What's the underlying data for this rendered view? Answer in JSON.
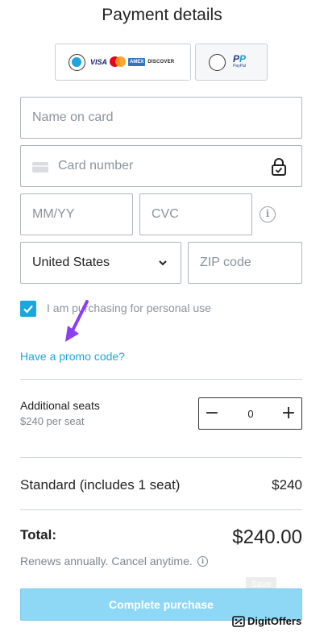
{
  "header": {
    "title": "Payment details"
  },
  "payment_methods": {
    "card": {
      "selected": true,
      "brands": [
        "VISA",
        "AMEX",
        "DISCOVER"
      ]
    },
    "paypal": {
      "selected": false,
      "mark": "PayPal",
      "word": "PayPal"
    }
  },
  "form": {
    "name_placeholder": "Name on card",
    "card_number_placeholder": "Card number",
    "expiry_placeholder": "MM/YY",
    "cvc_placeholder": "CVC",
    "country_selected": "United States",
    "zip_placeholder": "ZIP code",
    "personal_use_label": "I am purchasing for personal use",
    "personal_use_checked": true,
    "promo_link": "Have a promo code?"
  },
  "seats": {
    "title": "Additional seats",
    "price_per_seat": "$240 per seat",
    "minus": "−",
    "value": "0",
    "plus": "+"
  },
  "summary": {
    "plan_label": "Standard (includes 1 seat)",
    "plan_price": "$240",
    "total_label": "Total:",
    "total_value": "$240.00",
    "renew_note": "Renews annually. Cancel anytime.",
    "info_glyph": "i"
  },
  "actions": {
    "save_badge": "Save",
    "complete_label": "Complete purchase"
  },
  "watermark": {
    "text": "DigitOffers"
  },
  "colors": {
    "accent": "#1ba6e0",
    "button_disabled": "#8fd8f5",
    "annotation_arrow": "#8a3ff0"
  }
}
